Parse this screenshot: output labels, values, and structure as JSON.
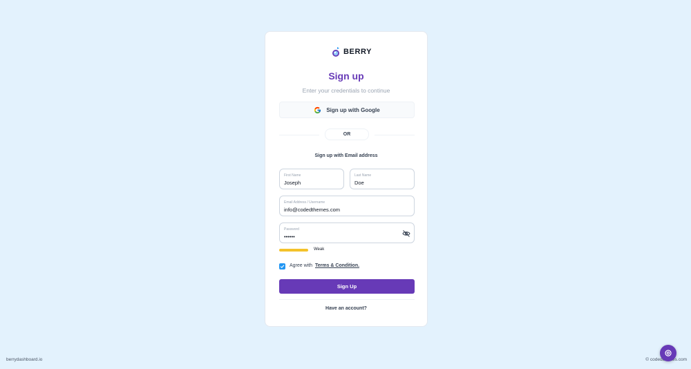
{
  "brand": {
    "name": "BERRY",
    "accent_color": "#673ab7",
    "logo_icon": "berry-logo-icon"
  },
  "auth": {
    "title": "Sign up",
    "subtitle": "Enter your credentials to continue",
    "google_button_label": "Sign up with Google",
    "google_icon": "google-icon",
    "or_label": "OR",
    "email_signup_label": "Sign up with Email address",
    "fields": {
      "first_name": {
        "label": "First Name",
        "value": "Joseph"
      },
      "last_name": {
        "label": "Last Name",
        "value": "Doe"
      },
      "email": {
        "label": "Email Address / Username",
        "value": "info@codedthemes.com"
      },
      "password": {
        "label": "Password",
        "value": "••••••",
        "toggle_icon": "eye-off-icon"
      }
    },
    "password_strength": {
      "label": "Weak",
      "color": "#f4c22b",
      "level": 0.2
    },
    "agree": {
      "checked": true,
      "text": "Agree with",
      "link_label": "Terms & Condition."
    },
    "submit_label": "Sign Up",
    "have_account_label": "Have an account?"
  },
  "footer": {
    "left_link": "berrydashboard.io",
    "right_text": "© codedthemes.com"
  },
  "fab": {
    "icon": "settings-icon"
  }
}
